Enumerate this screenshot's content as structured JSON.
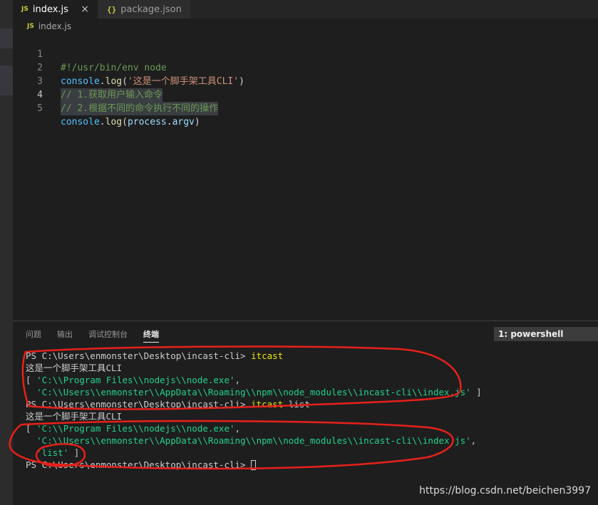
{
  "tabs": [
    {
      "icon": "JS",
      "label": "index.js",
      "close": "×"
    },
    {
      "icon": "{}",
      "label": "package.json"
    }
  ],
  "breadcrumb": {
    "icon": "JS",
    "label": "index.js"
  },
  "editor": {
    "lines": [
      {
        "num": "1",
        "text": "#!/usr/bin/env node"
      },
      {
        "num": "2",
        "text_a": "console",
        "text_b": ".",
        "text_c": "log",
        "text_d": "(",
        "text_e": "'这是一个脚手架工具CLI'",
        "text_f": ")"
      },
      {
        "num": "3",
        "text": "// 1.获取用户输入命令"
      },
      {
        "num": "4",
        "text": "// 2.根据不同的命令执行不同的操作"
      },
      {
        "num": "5",
        "text_a": "console",
        "text_b": ".",
        "text_c": "log",
        "text_d": "(",
        "text_e": "process",
        "text_f": ".",
        "text_g": "argv",
        "text_h": ")"
      }
    ]
  },
  "panel": {
    "tabs": [
      "问题",
      "输出",
      "调试控制台",
      "终端"
    ],
    "active_tab": "终端",
    "terminal_select": "1: powershell"
  },
  "terminal": {
    "lines": [
      {
        "prompt": "PS C:\\Users\\enmonster\\Desktop\\incast-cli> ",
        "cmd": "itcast"
      },
      {
        "text": "这是一个脚手架工具CLI"
      },
      {
        "pre": "[ ",
        "str": "'C:\\\\Program Files\\\\nodejs\\\\node.exe'",
        "post": ","
      },
      {
        "pre": "  ",
        "str": "'C:\\\\Users\\\\enmonster\\\\AppData\\\\Roaming\\\\npm\\\\node_modules\\\\incast-cli\\\\index.js'",
        "post": " ]"
      },
      {
        "prompt": "PS C:\\Users\\enmonster\\Desktop\\incast-cli> ",
        "cmd": "itcast",
        "arg": " list"
      },
      {
        "text": "这是一个脚手架工具CLI"
      },
      {
        "pre": "[ ",
        "str": "'C:\\\\Program Files\\\\nodejs\\\\node.exe'",
        "post": ","
      },
      {
        "pre": "  ",
        "str": "'C:\\\\Users\\\\enmonster\\\\AppData\\\\Roaming\\\\npm\\\\node_modules\\\\incast-cli\\\\index.js'",
        "post": ","
      },
      {
        "pre": "  ",
        "str": "'list'",
        "post": " ]"
      },
      {
        "prompt": "PS C:\\Users\\enmonster\\Desktop\\incast-cli> "
      }
    ]
  },
  "watermark": "https://blog.csdn.net/beichen3997",
  "colors": {
    "annotation": "#e8201a",
    "string": "#23d18b",
    "command": "#e5e510"
  }
}
